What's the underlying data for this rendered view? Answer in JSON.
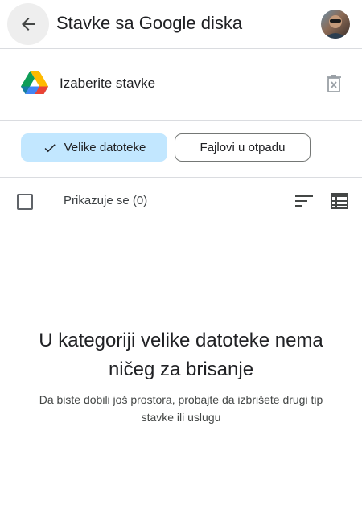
{
  "app_bar": {
    "title": "Stavke sa Google diska",
    "back_icon": "arrow-left-icon",
    "avatar_icon": "user-avatar"
  },
  "source": {
    "label": "Izaberite stavke",
    "logo_icon": "google-drive-logo",
    "trash_icon": "clear-trash-icon"
  },
  "filters": [
    {
      "label": "Velike datoteke",
      "selected": true,
      "icon": "check-icon"
    },
    {
      "label": "Fajlovi u otpadu",
      "selected": false
    }
  ],
  "list_header": {
    "count_label": "Prikazuje se (0)",
    "sort_icon": "sort-icon",
    "view_icon": "list-view-icon"
  },
  "empty_state": {
    "title_line1": "U kategoriji velike datoteke nema",
    "title_line2": "ničeg za brisanje",
    "subtitle_line1": "Da biste dobili još prostora, probajte da izbrišete drugi tip",
    "subtitle_line2": "stavke ili uslugu"
  },
  "colors": {
    "selected_chip_bg": "#c2e7ff",
    "divider": "#dadce0",
    "text_primary": "#202124",
    "icon_gray": "#5f6368"
  }
}
